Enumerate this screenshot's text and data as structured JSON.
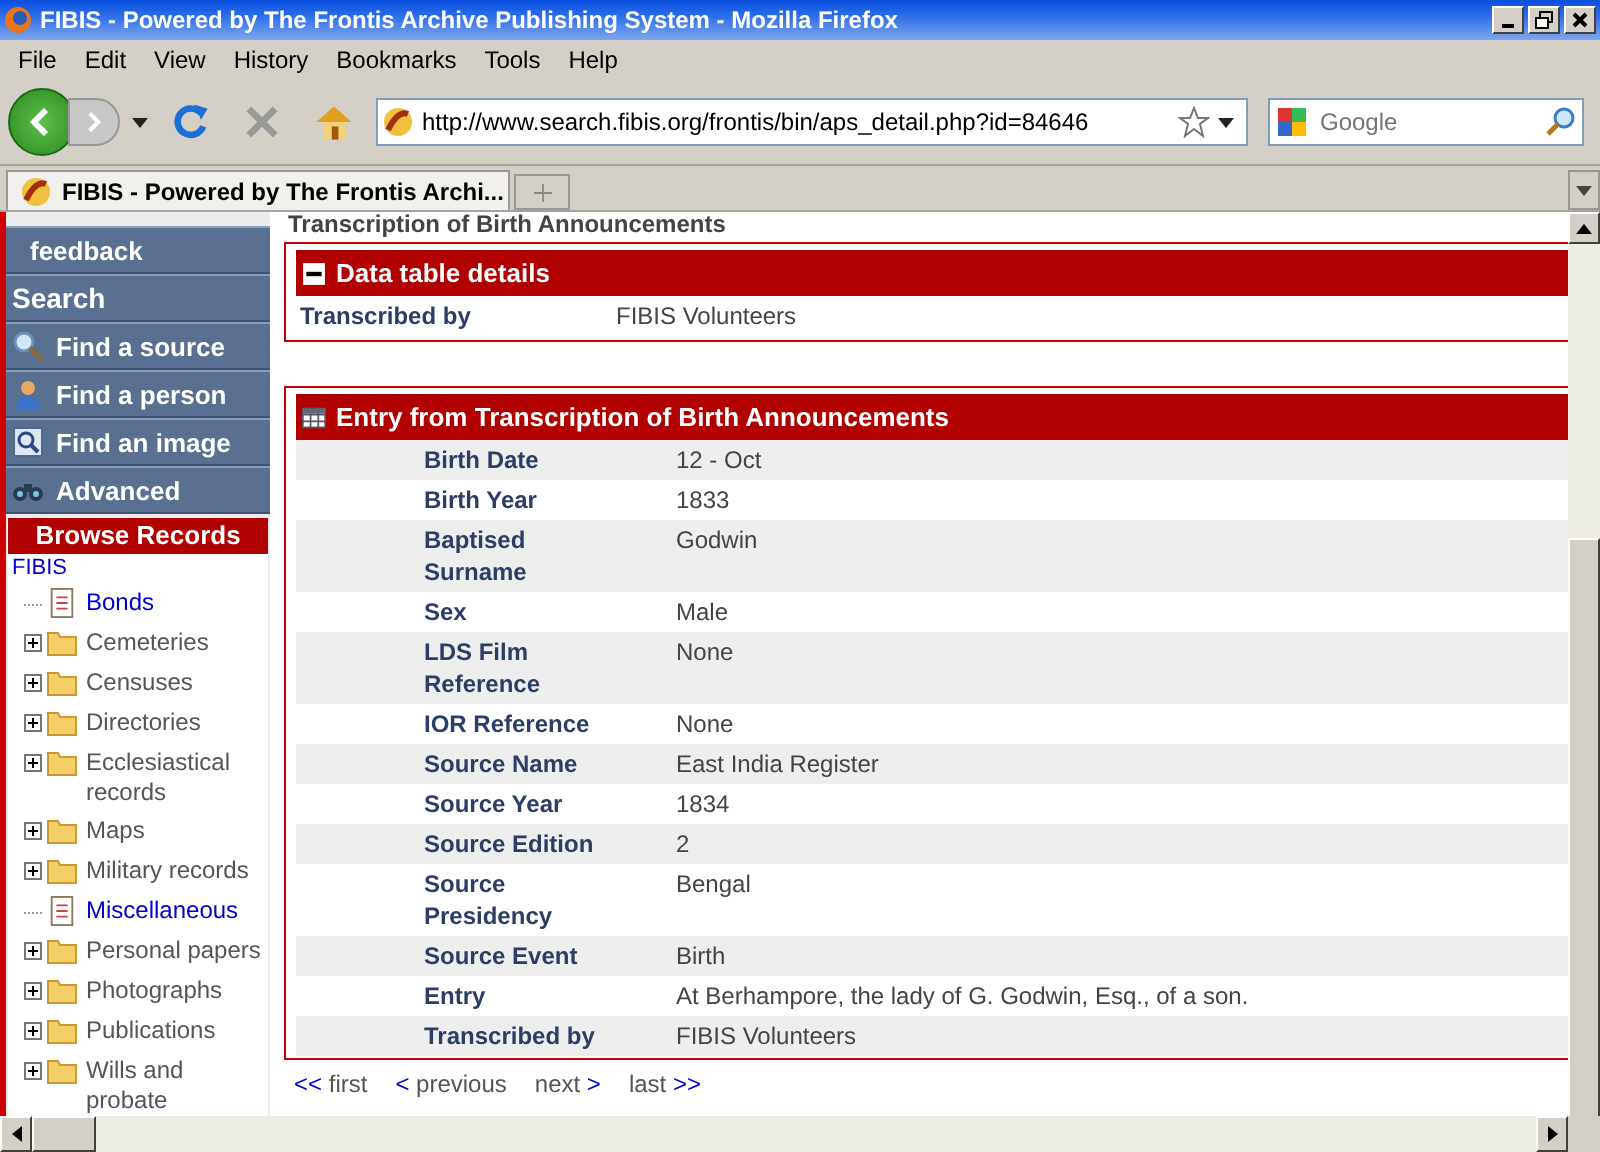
{
  "window": {
    "title": "FIBIS - Powered by The Frontis Archive Publishing System - Mozilla Firefox"
  },
  "menu": [
    "File",
    "Edit",
    "View",
    "History",
    "Bookmarks",
    "Tools",
    "Help"
  ],
  "address": {
    "value": "http://www.search.fibis.org/frontis/bin/aps_detail.php?id=84646"
  },
  "search": {
    "placeholder": "Google"
  },
  "tabs": [
    {
      "label": "FIBIS - Powered by The Frontis Archi...",
      "selected": true
    }
  ],
  "sidebar": {
    "items": [
      {
        "label": "feedback",
        "kind": "link"
      },
      {
        "label": "Search",
        "kind": "heading"
      },
      {
        "label": "Find a source",
        "kind": "source"
      },
      {
        "label": "Find a person",
        "kind": "person"
      },
      {
        "label": "Find an image",
        "kind": "image"
      },
      {
        "label": "Advanced",
        "kind": "advanced"
      }
    ],
    "browse_title": "Browse Records",
    "tree_root": "FIBIS",
    "tree": [
      {
        "label": "Bonds",
        "kind": "page"
      },
      {
        "label": "Cemeteries",
        "kind": "folder"
      },
      {
        "label": "Censuses",
        "kind": "folder"
      },
      {
        "label": "Directories",
        "kind": "folder"
      },
      {
        "label": "Ecclesiastical records",
        "kind": "folder"
      },
      {
        "label": "Maps",
        "kind": "folder"
      },
      {
        "label": "Military records",
        "kind": "folder"
      },
      {
        "label": "Miscellaneous",
        "kind": "page"
      },
      {
        "label": "Personal papers",
        "kind": "folder"
      },
      {
        "label": "Photographs",
        "kind": "folder"
      },
      {
        "label": "Publications",
        "kind": "folder"
      },
      {
        "label": "Wills and probate",
        "kind": "folder"
      }
    ]
  },
  "page_heading": "Transcription of Birth Announcements",
  "details": {
    "title": "Data table details",
    "rows": [
      {
        "label": "Transcribed by",
        "value": "FIBIS Volunteers"
      }
    ]
  },
  "entry": {
    "title": "Entry from Transcription of Birth Announcements",
    "rows": [
      {
        "label": "Birth Date",
        "value": "12 - Oct"
      },
      {
        "label": "Birth Year",
        "value": "1833"
      },
      {
        "label": "Baptised Surname",
        "value": "Godwin"
      },
      {
        "label": "Sex",
        "value": "Male"
      },
      {
        "label": "LDS Film Reference",
        "value": "None"
      },
      {
        "label": "IOR Reference",
        "value": "None"
      },
      {
        "label": "Source Name",
        "value": "East India Register"
      },
      {
        "label": "Source Year",
        "value": "1834"
      },
      {
        "label": "Source Edition",
        "value": "2"
      },
      {
        "label": "Source Presidency",
        "value": "Bengal"
      },
      {
        "label": "Source Event",
        "value": "Birth"
      },
      {
        "label": "Entry",
        "value": "At Berhampore, the lady of G. Godwin, Esq., of a son."
      },
      {
        "label": "Transcribed by",
        "value": "FIBIS Volunteers"
      }
    ]
  },
  "pager": [
    {
      "arrow_before": "<<",
      "label": "first"
    },
    {
      "arrow_before": "<",
      "label": "previous"
    },
    {
      "label": "next",
      "arrow_after": ">"
    },
    {
      "label": "last",
      "arrow_after": ">>"
    }
  ]
}
